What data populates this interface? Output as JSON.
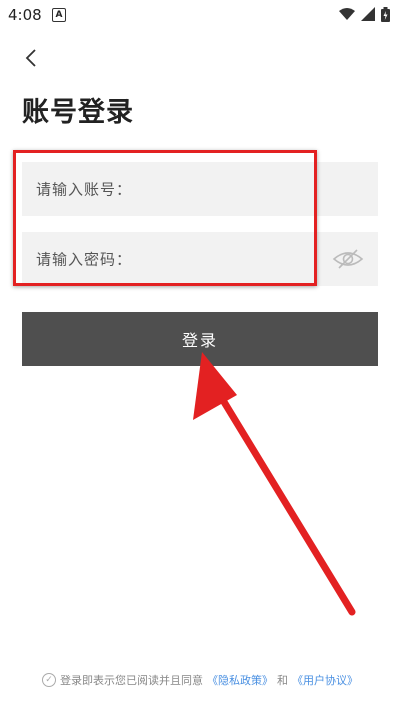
{
  "status_bar": {
    "time": "4:08",
    "notification_icon": "A"
  },
  "header": {
    "back_icon": "chevron-left-icon"
  },
  "page": {
    "title": "账号登录"
  },
  "form": {
    "account_placeholder": "请输入账号：",
    "password_placeholder": "请输入密码：",
    "login_label": "登录"
  },
  "agreement": {
    "prefix": "登录即表示您已阅读并且同意",
    "privacy_link": "《隐私政策》",
    "and": "和",
    "terms_link": "《用户协议》"
  },
  "colors": {
    "button_bg": "#4f4f4f",
    "highlight_red": "#e32122",
    "link_blue": "#4a90e2",
    "field_bg": "#f2f2f2"
  }
}
